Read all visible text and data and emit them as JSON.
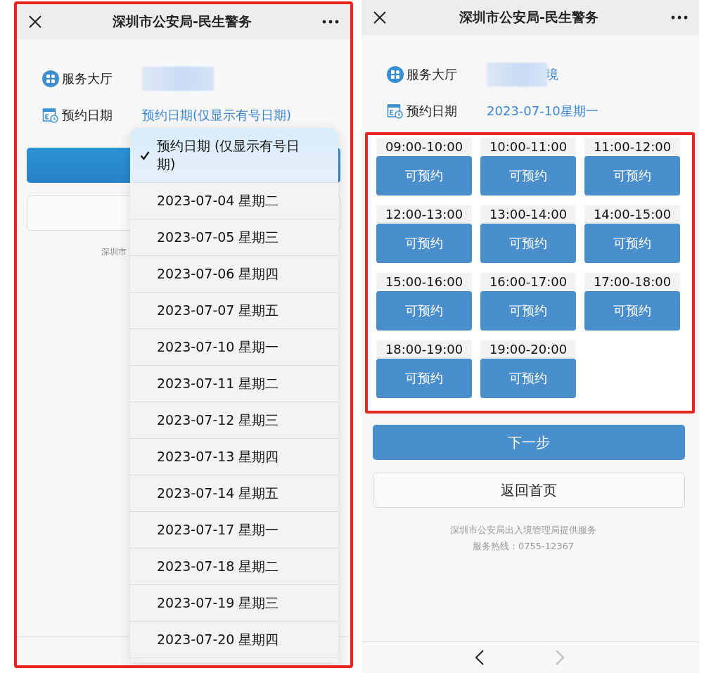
{
  "left_screen": {
    "title": "深圳市公安局-民生警务",
    "service_hall": {
      "label": "服务大厅"
    },
    "date": {
      "label": "预约日期",
      "value": "预约日期(仅显示有号日期)"
    },
    "footer_text": "深圳市",
    "date_menu": [
      {
        "label": "预约日期 (仅显示有号日期)",
        "selected": true
      },
      {
        "label": "2023-07-04 星期二",
        "selected": false
      },
      {
        "label": "2023-07-05 星期三",
        "selected": false
      },
      {
        "label": "2023-07-06 星期四",
        "selected": false
      },
      {
        "label": "2023-07-07 星期五",
        "selected": false
      },
      {
        "label": "2023-07-10 星期一",
        "selected": false
      },
      {
        "label": "2023-07-11 星期二",
        "selected": false
      },
      {
        "label": "2023-07-12 星期三",
        "selected": false
      },
      {
        "label": "2023-07-13 星期四",
        "selected": false
      },
      {
        "label": "2023-07-14 星期五",
        "selected": false
      },
      {
        "label": "2023-07-17 星期一",
        "selected": false
      },
      {
        "label": "2023-07-18 星期二",
        "selected": false
      },
      {
        "label": "2023-07-19 星期三",
        "selected": false
      },
      {
        "label": "2023-07-20 星期四",
        "selected": false
      }
    ]
  },
  "right_screen": {
    "title": "深圳市公安局-民生警务",
    "service_hall": {
      "label": "服务大厅",
      "value": "境"
    },
    "date": {
      "label": "预约日期",
      "value": "2023-07-10星期一"
    },
    "time_slots": [
      {
        "time": "09:00-10:00",
        "button": "可预约"
      },
      {
        "time": "10:00-11:00",
        "button": "可预约"
      },
      {
        "time": "11:00-12:00",
        "button": "可预约"
      },
      {
        "time": "12:00-13:00",
        "button": "可预约"
      },
      {
        "time": "13:00-14:00",
        "button": "可预约"
      },
      {
        "time": "14:00-15:00",
        "button": "可预约"
      },
      {
        "time": "15:00-16:00",
        "button": "可预约"
      },
      {
        "time": "16:00-17:00",
        "button": "可预约"
      },
      {
        "time": "17:00-18:00",
        "button": "可预约"
      },
      {
        "time": "18:00-19:00",
        "button": "可预约"
      },
      {
        "time": "19:00-20:00",
        "button": "可预约"
      }
    ],
    "next_button": "下一步",
    "home_button": "返回首页",
    "footer": [
      "深圳市公安局出入境管理局提供服务",
      "服务热线：0755-12367"
    ],
    "nav": [
      {
        "kind": "back",
        "disabled": false
      },
      {
        "kind": "forward",
        "disabled": true
      }
    ]
  }
}
